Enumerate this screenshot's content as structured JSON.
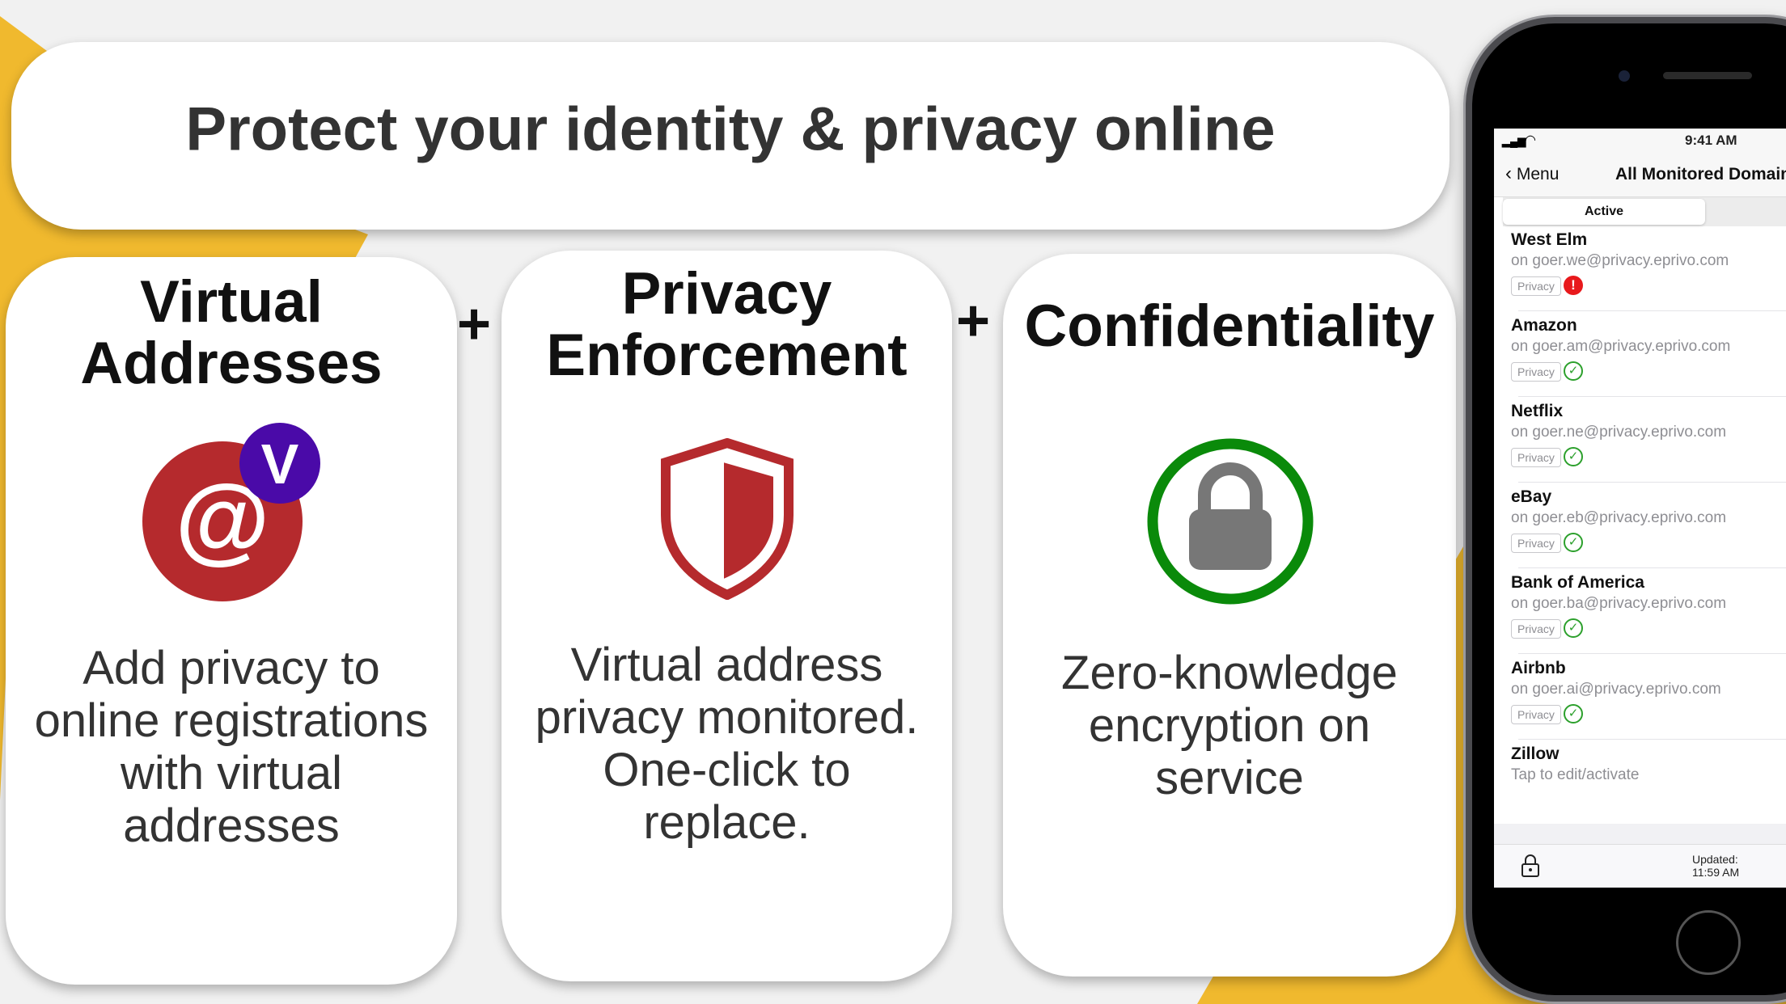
{
  "colors": {
    "accent_yellow": "#f0b92e",
    "brand_red": "#b52a2d",
    "badge_purple": "#4a0aa8",
    "ok_green": "#0a8a0a",
    "alert_red": "#e8191c"
  },
  "header": {
    "title": "Protect your identity & privacy online"
  },
  "plus": "+",
  "features": [
    {
      "title_lines": [
        "Virtual",
        "Addresses"
      ],
      "icon": "at-sign-with-v-badge-icon",
      "badge_letter": "V",
      "body_lines": [
        "Add privacy to",
        "online registrations",
        "with virtual",
        "addresses"
      ]
    },
    {
      "title_lines": [
        "Privacy",
        "Enforcement"
      ],
      "icon": "shield-icon",
      "body_lines": [
        "Virtual address",
        "privacy monitored.",
        "One-click to",
        "replace."
      ]
    },
    {
      "title_lines": [
        "Confidentiality"
      ],
      "icon": "padlock-ring-icon",
      "body_lines": [
        "Zero-knowledge",
        "encryption on",
        "service"
      ]
    }
  ],
  "phone": {
    "status_time": "9:41 AM",
    "nav": {
      "back_label": "Menu",
      "title": "All Monitored Domains"
    },
    "tabs": [
      {
        "label": "Active",
        "selected": true
      }
    ],
    "rows": [
      {
        "name": "West Elm",
        "email": "on goer.we@privacy.eprivo.com",
        "badge": "Privacy",
        "status": "alert"
      },
      {
        "name": "Amazon",
        "email": "on goer.am@privacy.eprivo.com",
        "badge": "Privacy",
        "status": "ok"
      },
      {
        "name": "Netflix",
        "email": "on goer.ne@privacy.eprivo.com",
        "badge": "Privacy",
        "status": "ok"
      },
      {
        "name": "eBay",
        "email": "on goer.eb@privacy.eprivo.com",
        "badge": "Privacy",
        "status": "ok"
      },
      {
        "name": "Bank of America",
        "email": "on goer.ba@privacy.eprivo.com",
        "badge": "Privacy",
        "status": "ok"
      },
      {
        "name": "Airbnb",
        "email": "on goer.ai@privacy.eprivo.com",
        "badge": "Privacy",
        "status": "ok"
      },
      {
        "name": "Zillow",
        "email": "Tap to edit/activate",
        "badge": null,
        "status": null
      }
    ],
    "footer": {
      "updated_label": "Updated:",
      "updated_time": "11:59 AM"
    }
  }
}
